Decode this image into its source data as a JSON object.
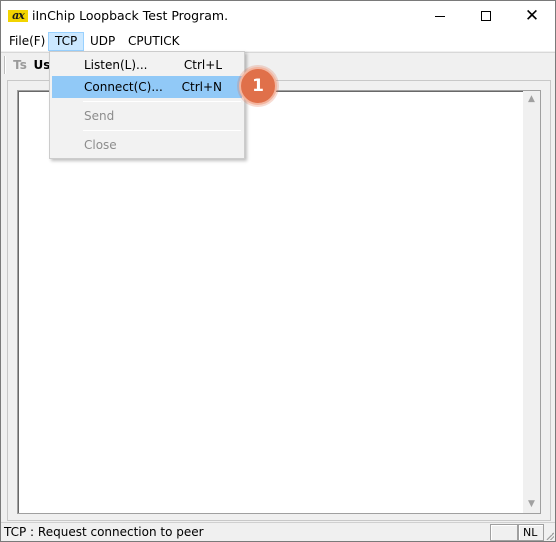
{
  "window": {
    "icon_text": "ax",
    "title": "iInChip Loopback Test Program.",
    "minimize_glyph": "",
    "maximize_glyph": "",
    "close_glyph": "✕"
  },
  "menubar": {
    "items": [
      {
        "label": "File(F)"
      },
      {
        "label": "TCP"
      },
      {
        "label": "UDP"
      },
      {
        "label": "CPUTICK"
      }
    ],
    "active": "TCP"
  },
  "toolbar": {
    "buttons": [
      {
        "label": "Ts",
        "enabled": false
      },
      {
        "label": "Us",
        "enabled": true
      }
    ]
  },
  "tcp_menu": {
    "items": [
      {
        "label": "Listen(L)...",
        "shortcut": "Ctrl+L",
        "enabled": true
      },
      {
        "label": "Connect(C)...",
        "shortcut": "Ctrl+N",
        "enabled": true,
        "highlighted": true
      },
      {
        "label": "Send",
        "shortcut": "",
        "enabled": false
      },
      {
        "label": "Close",
        "shortcut": "",
        "enabled": false
      }
    ]
  },
  "callout": {
    "number": "1",
    "color": "#e0704a"
  },
  "scrollbar": {
    "up_arrow": "▲",
    "down_arrow": "▼"
  },
  "statusbar": {
    "message": "TCP : Request connection to peer",
    "pane1": "",
    "pane2": "NL"
  },
  "colors": {
    "menu_highlight": "#91c9f7",
    "menu_active": "#cce8ff"
  }
}
